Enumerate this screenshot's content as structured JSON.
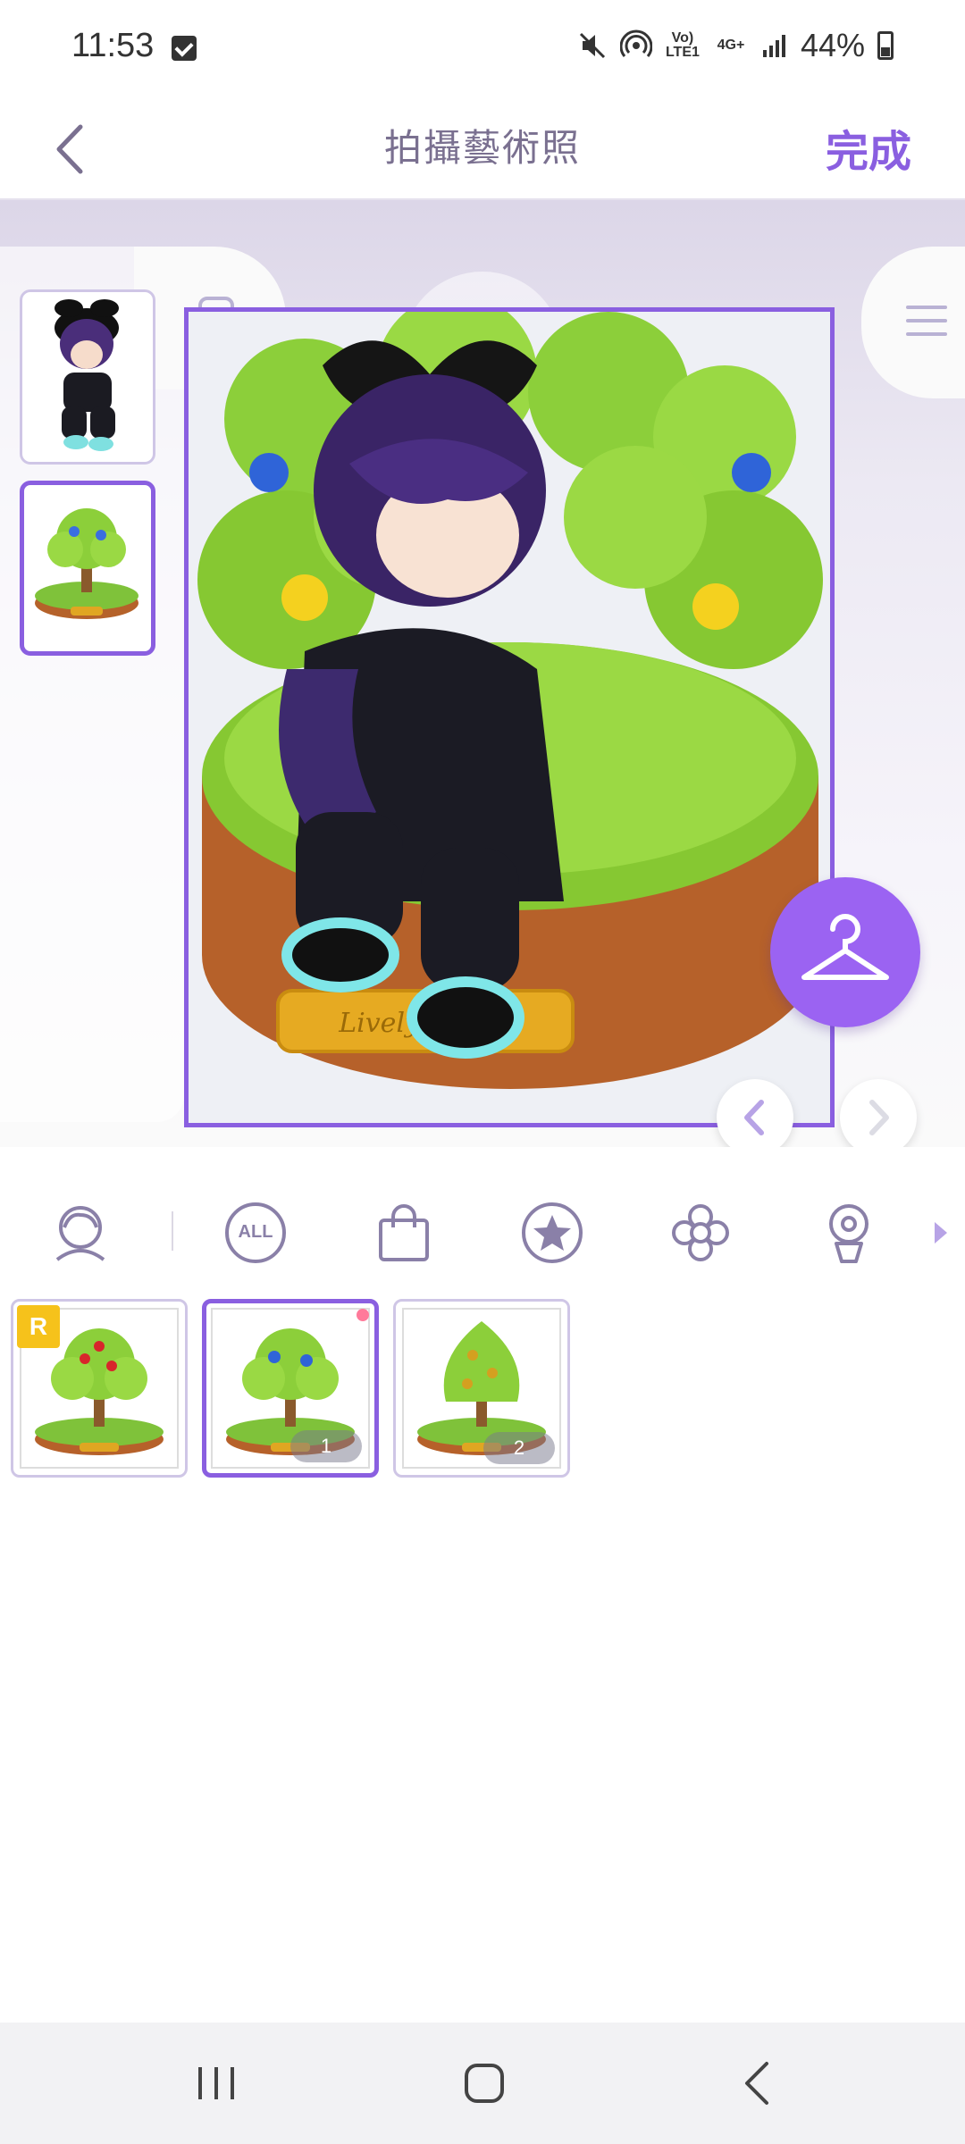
{
  "status_bar": {
    "time": "11:53",
    "network_top": "Vo) LTE1",
    "network_4g": "4G+",
    "battery": "44%"
  },
  "header": {
    "title": "拍攝藝術照",
    "done_label": "完成"
  },
  "stage": {
    "plaque_text": "Lively Island"
  },
  "categories": [
    {
      "icon": "avatar-icon"
    },
    {
      "icon": "all-icon",
      "label": "ALL"
    },
    {
      "icon": "shopping-bag-icon"
    },
    {
      "icon": "star-icon"
    },
    {
      "icon": "flower-icon"
    },
    {
      "icon": "potted-flower-icon"
    }
  ],
  "items": [
    {
      "rarity": "R",
      "count": ""
    },
    {
      "rarity": "",
      "count": "1"
    },
    {
      "rarity": "",
      "count": "2"
    }
  ],
  "colors": {
    "accent": "#8a5fe0",
    "hanger_button": "#9b63f2",
    "rarity_badge": "#f6c21b"
  }
}
